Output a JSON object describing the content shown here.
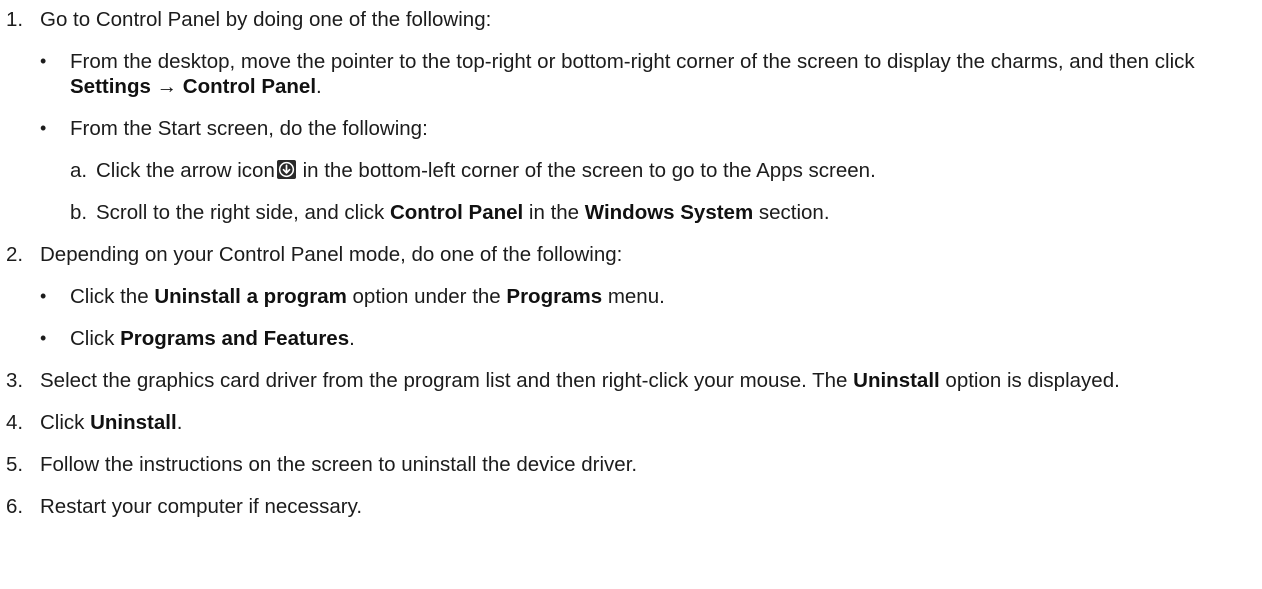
{
  "steps": [
    {
      "num": "1.",
      "text": "Go to Control Panel by doing one of the following:",
      "bullets": [
        {
          "pre": "From the desktop, move the pointer to the top-right or bottom-right corner of the screen to display the charms, and then click ",
          "bold": "Settings → Control Panel",
          "post": "."
        },
        {
          "text": "From the Start screen, do the following:",
          "alpha": [
            {
              "mark": "a.",
              "pre": "Click the arrow icon",
              "icon": "circle-down-arrow-icon",
              "post": "in the bottom-left corner of the screen to go to the Apps screen."
            },
            {
              "mark": "b.",
              "pre": "Scroll to the right side, and click ",
              "bold1": "Control Panel",
              "mid": " in the ",
              "bold2": "Windows System",
              "post": " section."
            }
          ]
        }
      ]
    },
    {
      "num": "2.",
      "text": "Depending on your Control Panel mode, do one of the following:",
      "bullets": [
        {
          "pre": "Click the ",
          "bold1": "Uninstall a program",
          "mid": " option under the ",
          "bold2": "Programs",
          "post": " menu."
        },
        {
          "pre": "Click ",
          "bold": "Programs and Features",
          "post": "."
        }
      ]
    },
    {
      "num": "3.",
      "pre": "Select the graphics card driver from the program list and then right-click your mouse. The ",
      "bold": "Uninstall",
      "post": " option is displayed."
    },
    {
      "num": "4.",
      "pre": "Click ",
      "bold": "Uninstall",
      "post": "."
    },
    {
      "num": "5.",
      "text": "Follow the instructions on the screen to uninstall the device driver."
    },
    {
      "num": "6.",
      "text": "Restart your computer if necessary."
    }
  ],
  "bullet_char": "•"
}
